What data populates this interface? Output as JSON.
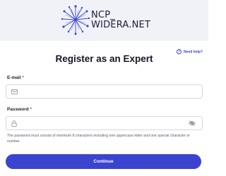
{
  "brand": {
    "line1": "NCP_",
    "line2": "WIDERA.NET",
    "logo_icon": "starburst-icon",
    "accent_color": "#3a44cf"
  },
  "help": {
    "label": "Need help?",
    "icon": "question-circle-icon"
  },
  "page": {
    "title": "Register as an Expert"
  },
  "form": {
    "email": {
      "label": "E-mail",
      "required_marker": "*",
      "value": "",
      "icon": "envelope-icon"
    },
    "password": {
      "label": "Password",
      "required_marker": "*",
      "value": "",
      "icon": "lock-icon",
      "toggle_icon": "eye-slash-icon"
    },
    "hint": "The password must consist of minimum 8 characters including one uppercase letter and one special character or number.",
    "submit_label": "Continue"
  }
}
